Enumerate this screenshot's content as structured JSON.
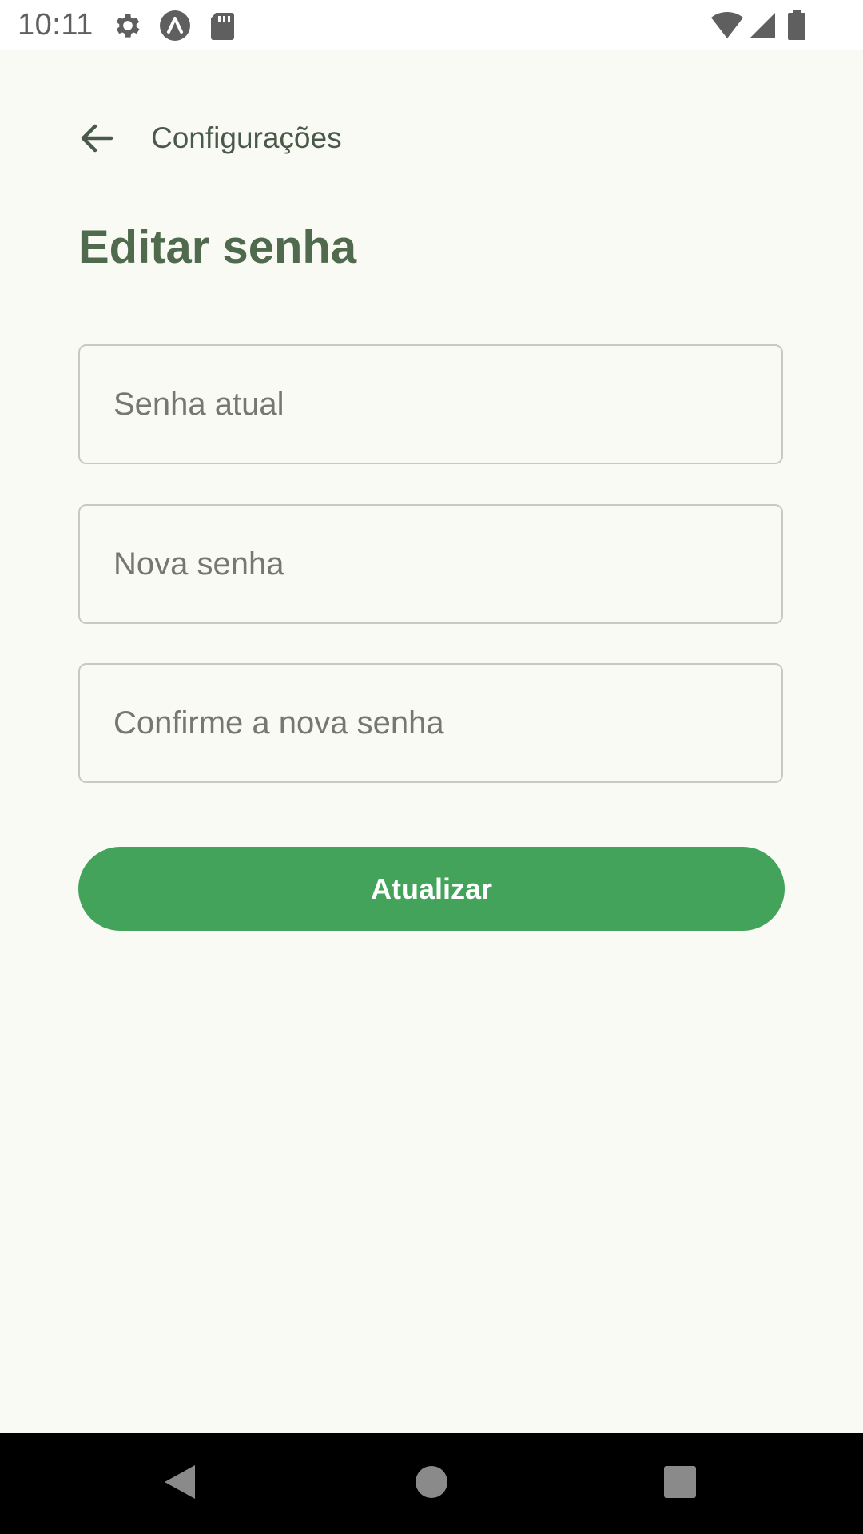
{
  "status_bar": {
    "time": "10:11",
    "left_icons": [
      "settings-icon",
      "app-icon",
      "sd-card-icon"
    ],
    "right_icons": [
      "wifi-icon",
      "signal-icon",
      "battery-icon"
    ]
  },
  "top_bar": {
    "back_icon": "arrow-left-icon",
    "back_label": "Configurações"
  },
  "page": {
    "title": "Editar senha"
  },
  "form": {
    "current_password": {
      "value": "",
      "placeholder": "Senha atual"
    },
    "new_password": {
      "value": "",
      "placeholder": "Nova senha"
    },
    "confirm_password": {
      "value": "",
      "placeholder": "Confirme a nova senha"
    },
    "submit_label": "Atualizar"
  },
  "nav_bar": {
    "icons": [
      "back-triangle-icon",
      "home-circle-icon",
      "recents-square-icon"
    ]
  },
  "colors": {
    "background": "#fafaf5",
    "title": "#4f6a4c",
    "accent": "#43a35b",
    "field_border": "#c8c8c4",
    "nav_bar": "#000000"
  }
}
